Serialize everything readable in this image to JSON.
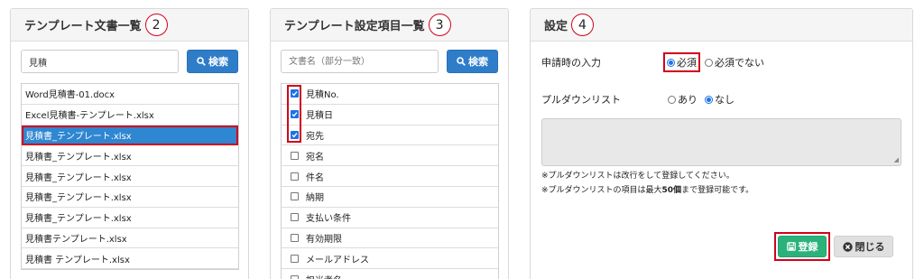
{
  "panel1": {
    "title": "テンプレート文書一覧",
    "step": "2",
    "search_value": "見積",
    "search_button": "検索",
    "items": [
      "Word見積書-01.docx",
      "Excel見積書-テンプレート.xlsx",
      "見積書_テンプレート.xlsx",
      "見積書_テンプレート.xlsx",
      "見積書_テンプレート.xlsx",
      "見積書_テンプレート.xlsx",
      "見積書_テンプレート.xlsx",
      "見積書テンプレート.xlsx",
      "見積書 テンプレート.xlsx"
    ],
    "selected_index": 2
  },
  "panel2": {
    "title": "テンプレート設定項目一覧",
    "step": "3",
    "search_placeholder": "文書名（部分一致）",
    "search_button": "検索",
    "items": [
      {
        "label": "見積No.",
        "checked": true
      },
      {
        "label": "見積日",
        "checked": true
      },
      {
        "label": "宛先",
        "checked": true
      },
      {
        "label": "宛名",
        "checked": false
      },
      {
        "label": "件名",
        "checked": false
      },
      {
        "label": "納期",
        "checked": false
      },
      {
        "label": "支払い条件",
        "checked": false
      },
      {
        "label": "有効期限",
        "checked": false
      },
      {
        "label": "メールアドレス",
        "checked": false
      },
      {
        "label": "担当者名",
        "checked": false
      }
    ]
  },
  "panel3": {
    "title": "設定",
    "step": "4",
    "required_label": "申請時の入力",
    "required_opt1": "必須",
    "required_opt2": "必須でない",
    "dropdown_label": "プルダウンリスト",
    "dropdown_opt1": "あり",
    "dropdown_opt2": "なし",
    "note1": "※プルダウンリストは改行をして登録してください。",
    "note2_prefix": "※プルダウンリストの項目は最大",
    "note2_bold": "50個",
    "note2_suffix": "まで登録可能です。",
    "save_button": "登録",
    "close_button": "閉じる"
  },
  "colors": {
    "primary": "#2f7dc9",
    "selected_row": "#2f86d1",
    "highlight": "#d0021b",
    "save": "#2ab27b"
  }
}
